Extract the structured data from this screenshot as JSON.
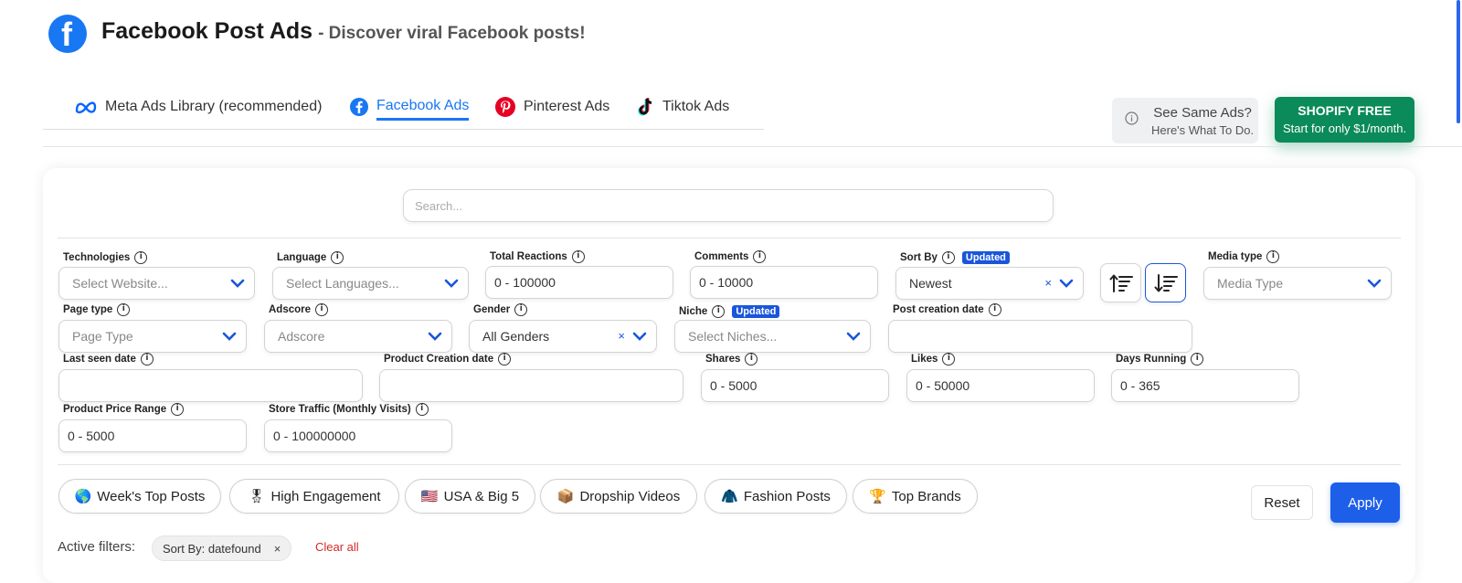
{
  "header": {
    "title": "Facebook Post Ads",
    "subtitle": "- Discover viral Facebook posts!"
  },
  "tabs": [
    {
      "label": "Meta Ads Library (recommended)",
      "icon": "meta-icon"
    },
    {
      "label": "Facebook Ads",
      "icon": "facebook-icon",
      "active": true
    },
    {
      "label": "Pinterest Ads",
      "icon": "pinterest-icon"
    },
    {
      "label": "Tiktok Ads",
      "icon": "tiktok-icon"
    }
  ],
  "same_ads": {
    "line1": "See Same Ads?",
    "line2": "Here's What To Do."
  },
  "shopify": {
    "line1": "SHOPIFY FREE",
    "line2": "Start for only $1/month."
  },
  "search": {
    "placeholder": "Search..."
  },
  "filters": {
    "technologies": {
      "label": "Technologies",
      "placeholder": "Select Website..."
    },
    "language": {
      "label": "Language",
      "placeholder": "Select Languages..."
    },
    "total_reactions": {
      "label": "Total Reactions",
      "value": "0 - 100000"
    },
    "comments": {
      "label": "Comments",
      "value": "0 - 10000"
    },
    "sort_by": {
      "label": "Sort By",
      "badge": "Updated",
      "value": "Newest",
      "clear": "×"
    },
    "media_type": {
      "label": "Media type",
      "placeholder": "Media Type"
    },
    "page_type": {
      "label": "Page type",
      "placeholder": "Page Type"
    },
    "adscore": {
      "label": "Adscore",
      "placeholder": "Adscore"
    },
    "gender": {
      "label": "Gender",
      "value": "All Genders",
      "clear": "×"
    },
    "niche": {
      "label": "Niche",
      "badge": "Updated",
      "placeholder": "Select Niches..."
    },
    "post_creation_date": {
      "label": "Post creation date",
      "value": ""
    },
    "last_seen_date": {
      "label": "Last seen date",
      "value": ""
    },
    "product_creation_date": {
      "label": "Product Creation date",
      "value": ""
    },
    "shares": {
      "label": "Shares",
      "value": "0 - 5000"
    },
    "likes": {
      "label": "Likes",
      "value": "0 - 50000"
    },
    "days_running": {
      "label": "Days Running",
      "value": "0 - 365"
    },
    "product_price_range": {
      "label": "Product Price Range",
      "value": "0 - 5000"
    },
    "store_traffic": {
      "label": "Store Traffic (Monthly Visits)",
      "value": "0 - 100000000"
    }
  },
  "presets": [
    {
      "emoji": "🌎",
      "label": "Week's Top Posts"
    },
    {
      "emoji": "🎖",
      "label": "High Engagement"
    },
    {
      "emoji": "🇺🇸",
      "label": "USA & Big 5"
    },
    {
      "emoji": "📦",
      "label": "Dropship Videos"
    },
    {
      "emoji": "🧥",
      "label": "Fashion Posts"
    },
    {
      "emoji": "🏆",
      "label": "Top Brands"
    }
  ],
  "actions": {
    "reset": "Reset",
    "apply": "Apply"
  },
  "active_filters": {
    "label": "Active filters:",
    "chips": [
      {
        "label": "Sort By: datefound",
        "remove": "×"
      }
    ],
    "clear_all": "Clear all"
  },
  "colors": {
    "accent": "#1a56db",
    "facebook": "#1877f2",
    "shopify": "#0b8a5a",
    "danger": "#d62828"
  }
}
